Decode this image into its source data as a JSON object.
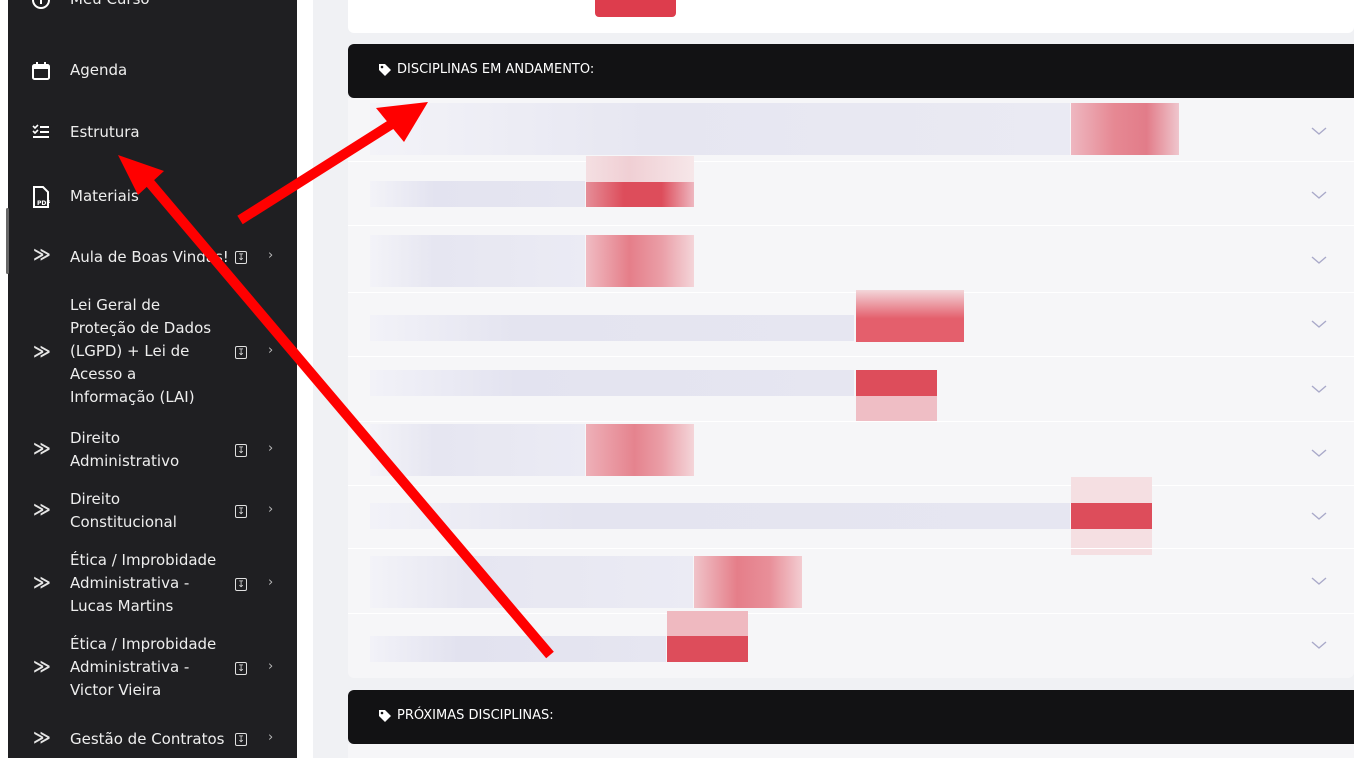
{
  "sidebar": {
    "items": [
      {
        "label": "Meu Curso",
        "icon": "info-circle-icon"
      },
      {
        "label": "Agenda",
        "icon": "calendar-icon"
      },
      {
        "label": "Estrutura",
        "icon": "checklist-icon"
      },
      {
        "label": "Materiais",
        "icon": "pdf-file-icon"
      }
    ],
    "sections": [
      {
        "label": "Aula de Boas Vindas!",
        "lines": [
          "Aula de Boas Vindas!"
        ]
      },
      {
        "label": "Lei Geral de Proteção de Dados (LGPD) + Lei de Acesso a Informação (LAI)",
        "lines": [
          "Lei Geral de",
          "Proteção de Dados",
          "(LGPD) + Lei de",
          "Acesso a",
          "Informação (LAI)"
        ]
      },
      {
        "label": "Direito Administrativo",
        "lines": [
          "Direito",
          "Administrativo"
        ]
      },
      {
        "label": "Direito Constitucional",
        "lines": [
          "Direito",
          "Constitucional"
        ]
      },
      {
        "label": "Ética / Improbidade Administrativa - Lucas Martins",
        "lines": [
          "Ética / Improbidade",
          "Administrativa -",
          "Lucas Martins"
        ]
      },
      {
        "label": "Ética / Improbidade Administrativa - Victor Vieira",
        "lines": [
          "Ética / Improbidade",
          "Administrativa -",
          "Victor Vieira"
        ]
      },
      {
        "label": "Gestão de Contratos",
        "lines": [
          "Gestão de Contratos"
        ]
      }
    ]
  },
  "main": {
    "in_progress_title": "DISCIPLINAS EM ANDAMENTO:",
    "upcoming_title": "PRÓXIMAS DISCIPLINAS:",
    "disciplines_count": 9
  },
  "colors": {
    "sidebar_bg": "#1f1f22",
    "header_bar_bg": "#121214",
    "accent_red": "#dd3d4d",
    "annotation_arrow": "#ff0000"
  }
}
